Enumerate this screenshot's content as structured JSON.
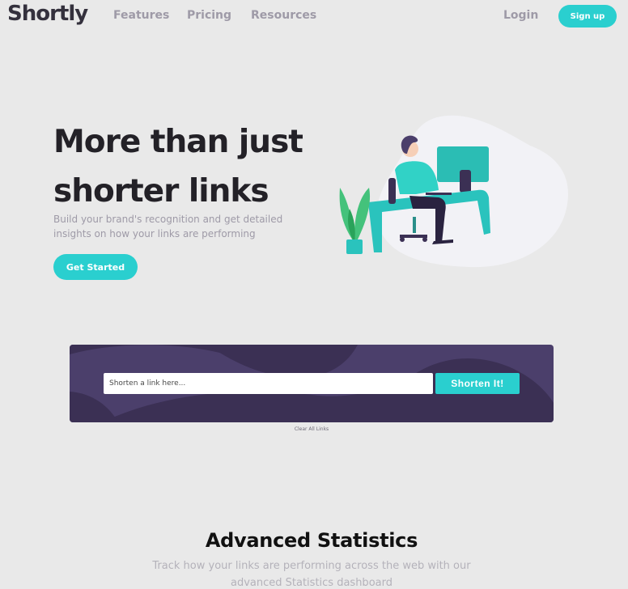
{
  "nav": {
    "logo": "Shortly",
    "links": [
      "Features",
      "Pricing",
      "Resources"
    ],
    "login": "Login",
    "signup": "Sign up"
  },
  "hero": {
    "title": "More than just shorter links",
    "subtitle": "Build your brand's recognition and get detailed insights on how your links are performing",
    "cta": "Get Started",
    "illustration": "person-working-at-desk-illustration"
  },
  "shorten": {
    "placeholder": "Shorten a link here...",
    "button": "Shorten It!",
    "clear": "Clear All Links"
  },
  "stats": {
    "title": "Advanced Statistics",
    "subtitle": "Track how your links are performing across the web with our advanced Statistics dashboard"
  },
  "colors": {
    "accent": "#2acfcf",
    "dark_violet": "#4b3f6b",
    "background": "#e9e9e9",
    "gray_text": "#9e9aa7"
  }
}
